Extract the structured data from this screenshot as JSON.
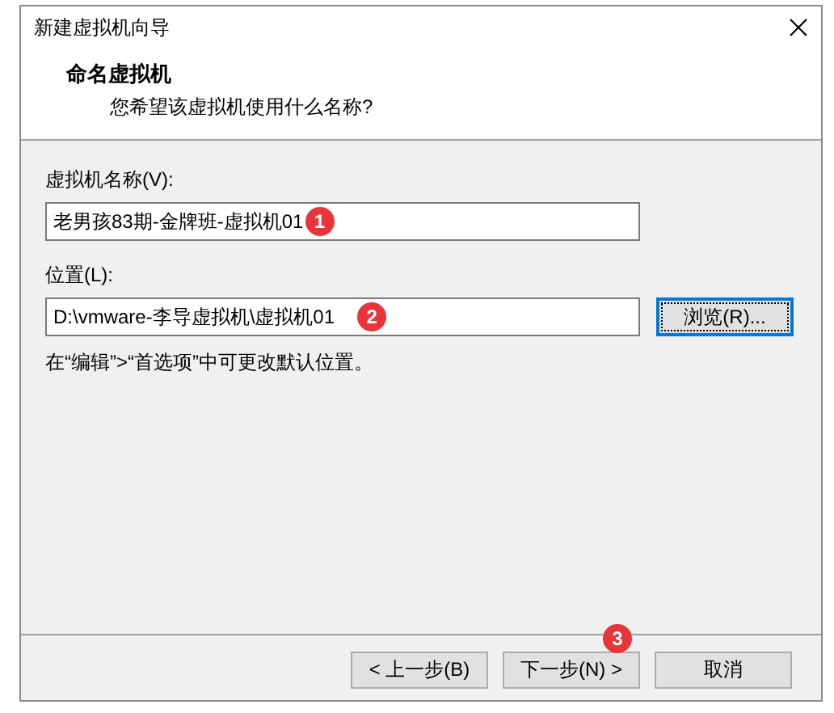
{
  "window": {
    "title": "新建虚拟机向导"
  },
  "header": {
    "title": "命名虚拟机",
    "subtitle": "您希望该虚拟机使用什么名称?"
  },
  "fields": [
    {
      "label": "虚拟机名称(V):",
      "value": "老男孩83期-金牌班-虚拟机01",
      "badge": "1"
    },
    {
      "label": "位置(L):",
      "value": "D:\\vmware-李导虚拟机\\虚拟机01",
      "badge": "2",
      "button": {
        "label": "浏览(R)...",
        "focused": true
      }
    }
  ],
  "hint": "在“编辑”>“首选项”中可更改默认位置。",
  "buttons": [
    {
      "label": "< 上一步(B)"
    },
    {
      "label": "下一步(N) >",
      "badge": "3"
    },
    {
      "label": "取消"
    }
  ]
}
